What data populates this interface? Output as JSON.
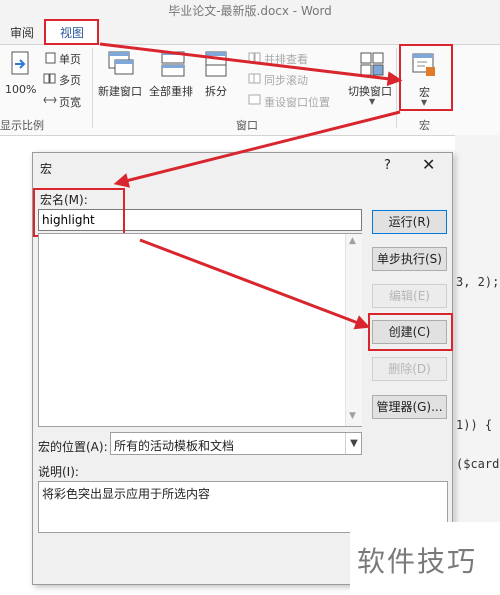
{
  "window": {
    "title": "毕业论文-最新版.docx - Word"
  },
  "tabs": {
    "review": "审阅",
    "view": "视图"
  },
  "ribbon": {
    "zoom100": "100%",
    "single_page": "单页",
    "multi_page": "多页",
    "page_width": "页宽",
    "zoom_group": "显示比例",
    "new_window": "新建窗口",
    "arrange_all": "全部重排",
    "split": "拆分",
    "side_by_side": "并排查看",
    "sync_scroll": "同步滚动",
    "reset_position": "重设窗口位置",
    "switch_window": "切换窗口",
    "window_group": "窗口",
    "macro_button": "宏",
    "macro_group": "宏"
  },
  "background_code": [
    "3, 2);",
    "1)) {",
    "($card"
  ],
  "dialog": {
    "title": "宏",
    "help": "?",
    "close": "✕",
    "macro_name_label": "宏名(M):",
    "macro_name_value": "highlight",
    "buttons": {
      "run": "运行(R)",
      "step": "单步执行(S)",
      "edit": "编辑(E)",
      "create": "创建(C)",
      "delete": "删除(D)",
      "organizer": "管理器(G)..."
    },
    "location_label": "宏的位置(A):",
    "location_value": "所有的活动模板和文档",
    "description_label": "说明(I):",
    "description_value": "将彩色突出显示应用于所选内容"
  },
  "watermark": "软件技巧",
  "colors": {
    "annotation_red": "#d9262e",
    "accent_blue": "#2b579a"
  }
}
